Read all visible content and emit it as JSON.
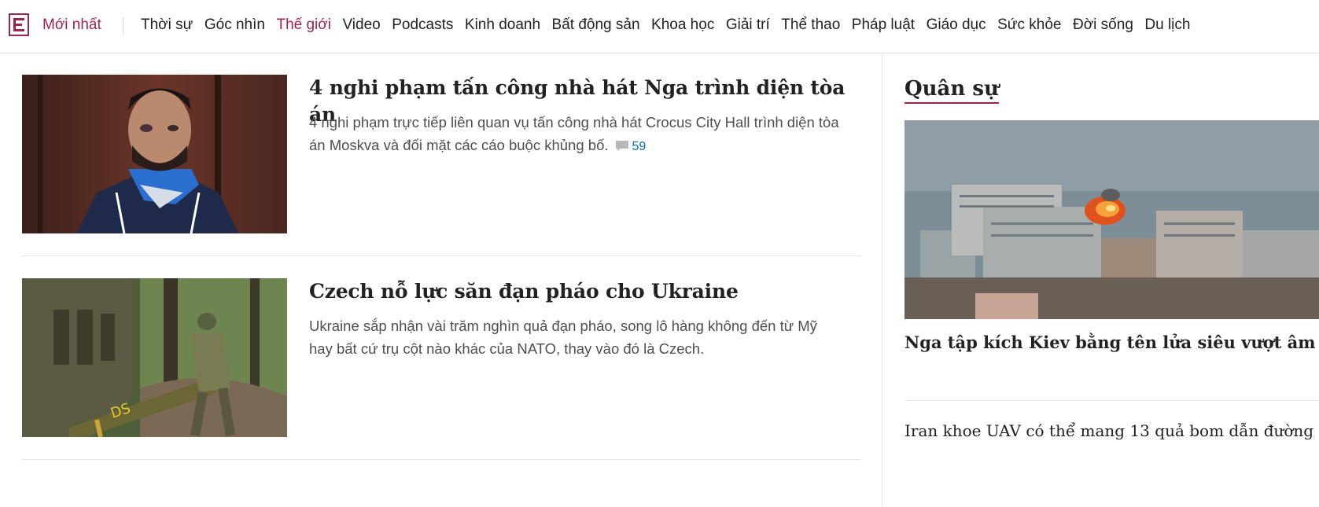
{
  "nav": {
    "latest": "Mới nhất",
    "items": [
      "Thời sự",
      "Góc nhìn",
      "Thế giới",
      "Video",
      "Podcasts",
      "Kinh doanh",
      "Bất động sản",
      "Khoa học",
      "Giải trí",
      "Thể thao",
      "Pháp luật",
      "Giáo dục",
      "Sức khỏe",
      "Đời sống",
      "Du lịch"
    ],
    "active": "Thế giới"
  },
  "colors": {
    "brand": "#9f224e",
    "link_blue": "#076db6"
  },
  "articles": [
    {
      "title": "4 nghi phạm tấn công nhà hát Nga trình diện tòa án",
      "summary": "4 nghi phạm trực tiếp liên quan vụ tấn công nhà hát Crocus City Hall trình diện tòa án Moskva và đối mặt các cáo buộc khủng bố.",
      "comments": "59",
      "image_icon": "suspect-photo"
    },
    {
      "title": "Czech nỗ lực săn đạn pháo cho Ukraine",
      "summary": "Ukraine sắp nhận vài trăm nghìn quả đạn pháo, song lô hàng không đến từ Mỹ hay bất cứ trụ cột nào khác của NATO, thay vào đó là Czech.",
      "image_icon": "artillery-shell-photo"
    }
  ],
  "sidebar": {
    "section_title": "Quân sự",
    "image_icon": "kiev-explosion-photo",
    "headline": "Nga tập kích Kiev bằng tên lửa siêu vượt âm",
    "items": [
      "Iran khoe UAV có thể mang 13 quả bom dẫn đường"
    ]
  }
}
